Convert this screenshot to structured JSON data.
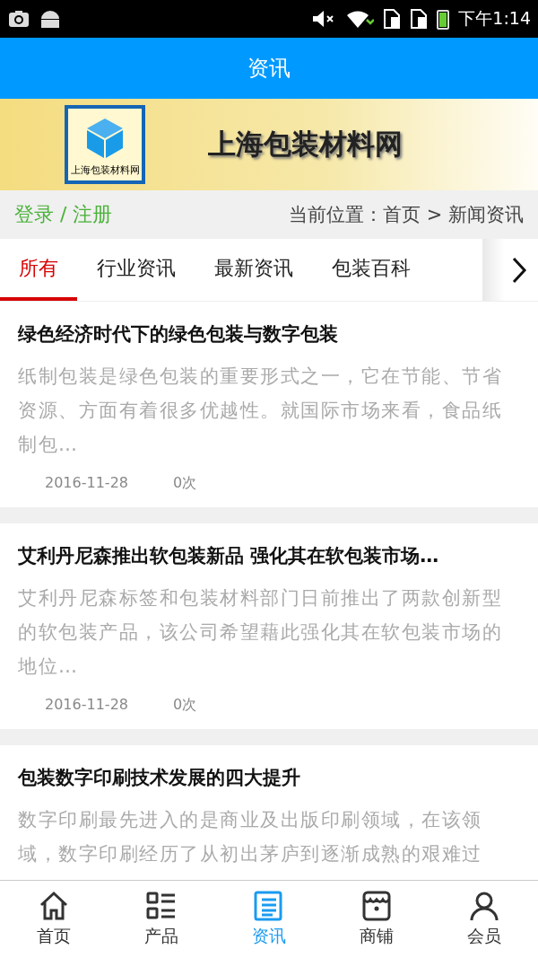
{
  "status_bar": {
    "time": "下午1:14"
  },
  "header": {
    "title": "资讯"
  },
  "banner": {
    "logo_text": "上海包装材料网",
    "site_name": "上海包装材料网"
  },
  "user_bar": {
    "login": "登录 / 注册",
    "breadcrumb": "当前位置：首页 > 新闻资讯"
  },
  "tabs": [
    {
      "label": "所有",
      "selected": true
    },
    {
      "label": "行业资讯",
      "selected": false
    },
    {
      "label": "最新资讯",
      "selected": false
    },
    {
      "label": "包装百科",
      "selected": false
    }
  ],
  "articles": [
    {
      "title": "绿色经济时代下的绿色包装与数字包装",
      "summary": "纸制包装是绿色包装的重要形式之一，它在节能、节省资源、方面有着很多优越性。就国际市场来看，食品纸制包…",
      "date": "2016-11-28",
      "views": "0次"
    },
    {
      "title": "艾利丹尼森推出软包装新品 强化其在软包装市场…",
      "summary": "艾利丹尼森标签和包装材料部门日前推出了两款创新型的软包装产品，该公司希望藉此强化其在软包装市场的地位…",
      "date": "2016-11-28",
      "views": "0次"
    },
    {
      "title": "包装数字印刷技术发展的四大提升",
      "summary": "数字印刷最先进入的是商业及出版印刷领域，在该领域，数字印刷经历了从初出茅庐到逐渐成熟的艰难过"
    }
  ],
  "bottom_nav": [
    {
      "label": "首页",
      "selected": false
    },
    {
      "label": "产品",
      "selected": false
    },
    {
      "label": "资讯",
      "selected": true
    },
    {
      "label": "商铺",
      "selected": false
    },
    {
      "label": "会员",
      "selected": false
    }
  ]
}
